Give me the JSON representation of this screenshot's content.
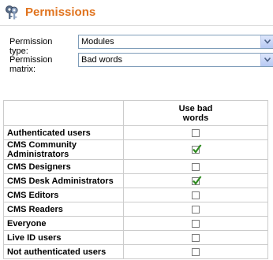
{
  "header": {
    "title": "Permissions",
    "icon": "keys-icon"
  },
  "form": {
    "permission_type": {
      "label": "Permission type:",
      "value": "Modules"
    },
    "permission_matrix": {
      "label": "Permission matrix:",
      "value": "Bad words"
    }
  },
  "matrix": {
    "column_header": {
      "line1": "Use bad",
      "line2": "words"
    },
    "rows": [
      {
        "name": "Authenticated users",
        "checked": false
      },
      {
        "name": "CMS Community Administrators",
        "checked": true
      },
      {
        "name": "CMS Designers",
        "checked": false
      },
      {
        "name": "CMS Desk Administrators",
        "checked": true
      },
      {
        "name": "CMS Editors",
        "checked": false
      },
      {
        "name": "CMS Readers",
        "checked": false
      },
      {
        "name": "Everyone",
        "checked": false
      },
      {
        "name": "Live ID users",
        "checked": false
      },
      {
        "name": "Not authenticated users",
        "checked": false
      }
    ]
  },
  "colors": {
    "title": "#e0731e",
    "check": "#2e8b1f",
    "border": "#cccccc"
  }
}
